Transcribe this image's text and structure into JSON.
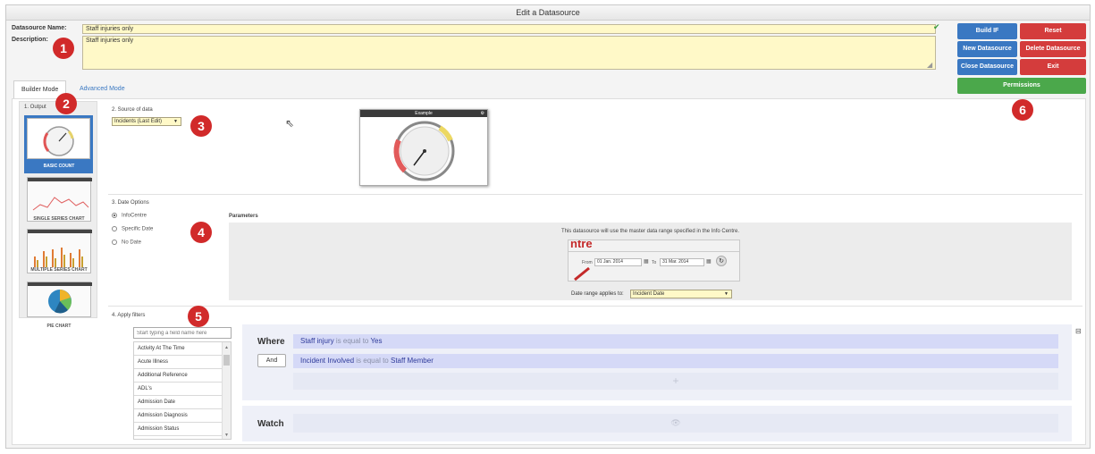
{
  "window": {
    "title": "Edit a Datasource"
  },
  "form": {
    "name_label": "Datasource Name:",
    "name_value": "Staff injuries only",
    "description_label": "Description:",
    "description_value": "Staff injuries only"
  },
  "buttons": {
    "build_if": "Build IF",
    "reset": "Reset",
    "new_datasource": "New Datasource",
    "delete_datasource": "Delete Datasource",
    "close_datasource": "Close Datasource",
    "exit": "Exit",
    "permissions": "Permissions"
  },
  "tabs": [
    {
      "label": "Builder Mode",
      "active": true
    },
    {
      "label": "Advanced Mode",
      "active": false
    }
  ],
  "badges": [
    "1",
    "2",
    "3",
    "4",
    "5",
    "6"
  ],
  "output": {
    "title": "1. Output",
    "options": [
      {
        "label": "BASIC COUNT",
        "selected": true
      },
      {
        "label": "SINGLE SERIES CHART",
        "selected": false
      },
      {
        "label": "MULTIPLE SERIES CHART",
        "selected": false
      },
      {
        "label": "PIE CHART",
        "selected": false
      }
    ]
  },
  "source": {
    "title": "2. Source of data",
    "selected": "Incidents (Last Edit)",
    "example_title": "Example"
  },
  "date_options": {
    "title": "3. Date Options",
    "options": [
      {
        "label": "InfoCentre",
        "selected": true
      },
      {
        "label": "Specific Date",
        "selected": false
      },
      {
        "label": "No Date",
        "selected": false
      }
    ],
    "parameters_label": "Parameters",
    "message": "This datasource will use the master data range specified in the Info Centre.",
    "snippet_title": "ntre",
    "from_label": "From",
    "from_value": "01 Jan. 2014",
    "to_label": "To",
    "to_value": "31 Mar. 2014",
    "applies_label": "Date range applies to:",
    "applies_value": "Incident Date"
  },
  "filters": {
    "title": "4. Apply filters",
    "search_placeholder": "Start typing a field name here",
    "fields": [
      "Activity At The Time",
      "Acute Illness",
      "Additional Reference",
      "ADL's",
      "Admission Date",
      "Admission Diagnosis",
      "Admission Status"
    ],
    "where_label": "Where",
    "and_label": "And",
    "watch_label": "Watch",
    "conditions": [
      {
        "field": "Staff injury",
        "op": "is equal to",
        "value": "Yes"
      },
      {
        "field": "Incident Involved",
        "op": "is equal to",
        "value": "Staff Member"
      }
    ],
    "add_symbol": "+",
    "collapse_symbol": "⊟",
    "watch_symbol": "👁"
  },
  "colors": {
    "blue": "#3a78c2",
    "red": "#d43c3c",
    "green": "#4ba84b",
    "field_yellow": "#fff9c8",
    "badge": "#d12a2a"
  }
}
